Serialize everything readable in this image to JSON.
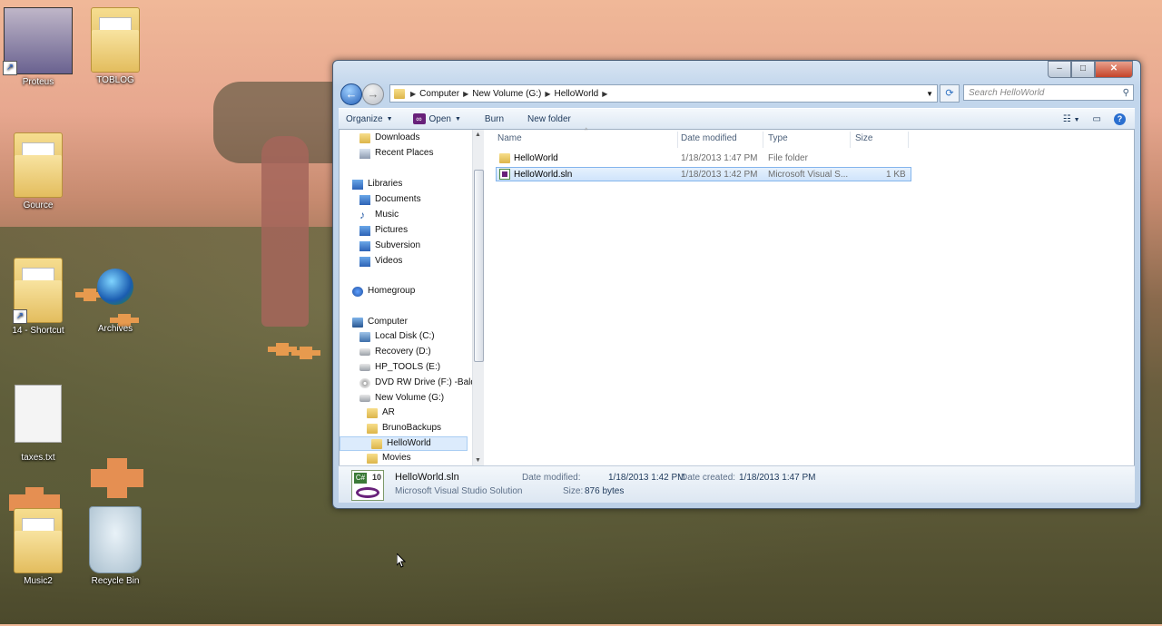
{
  "desktop": {
    "icons": [
      {
        "label": "Proteus"
      },
      {
        "label": "TOBLOG"
      },
      {
        "label": "Gource"
      },
      {
        "label": "14 - Shortcut"
      },
      {
        "label": "Archives"
      },
      {
        "label": "taxes.txt"
      },
      {
        "label": "Music2"
      },
      {
        "label": "Recycle Bin"
      }
    ]
  },
  "window": {
    "caption": {
      "minimize": "–",
      "maximize": "□",
      "close": "✕"
    },
    "address": {
      "segments": [
        "Computer",
        "New Volume (G:)",
        "HelloWorld"
      ]
    },
    "search": {
      "placeholder": "Search HelloWorld"
    },
    "toolbar": {
      "organize": "Organize",
      "open": "Open",
      "burn": "Burn",
      "new_folder": "New folder"
    },
    "nav": {
      "items": [
        {
          "label": "Downloads",
          "icon": "folder-icon"
        },
        {
          "label": "Recent Places",
          "icon": "recent-places-icon"
        },
        {
          "label": "Libraries",
          "icon": "libraries-icon"
        },
        {
          "label": "Documents",
          "icon": "documents-icon"
        },
        {
          "label": "Music",
          "icon": "music-icon"
        },
        {
          "label": "Pictures",
          "icon": "pictures-icon"
        },
        {
          "label": "Subversion",
          "icon": "subversion-icon"
        },
        {
          "label": "Videos",
          "icon": "videos-icon"
        },
        {
          "label": "Homegroup",
          "icon": "homegroup-icon"
        },
        {
          "label": "Computer",
          "icon": "computer-icon"
        },
        {
          "label": "Local Disk (C:)",
          "icon": "local-disk-icon"
        },
        {
          "label": "Recovery (D:)",
          "icon": "drive-icon"
        },
        {
          "label": "HP_TOOLS (E:)",
          "icon": "drive-icon"
        },
        {
          "label": "DVD RW Drive (F:) -Baldv",
          "icon": "dvd-icon"
        },
        {
          "label": "New Volume (G:)",
          "icon": "drive-icon"
        },
        {
          "label": "AR",
          "icon": "folder-icon"
        },
        {
          "label": "BrunoBackups",
          "icon": "folder-icon"
        },
        {
          "label": "HelloWorld",
          "icon": "folder-icon"
        },
        {
          "label": "Movies",
          "icon": "folder-icon"
        }
      ]
    },
    "columns": {
      "name": "Name",
      "date_modified": "Date modified",
      "type": "Type",
      "size": "Size"
    },
    "files": [
      {
        "name": "HelloWorld",
        "date": "1/18/2013 1:47 PM",
        "type": "File folder",
        "size": ""
      },
      {
        "name": "HelloWorld.sln",
        "date": "1/18/2013 1:42 PM",
        "type": "Microsoft Visual S...",
        "size": "1 KB"
      }
    ],
    "details": {
      "filename": "HelloWorld.sln",
      "filetype": "Microsoft Visual Studio Solution",
      "date_modified_label": "Date modified:",
      "date_modified": "1/18/2013 1:42 PM",
      "size_label": "Size:",
      "size": "876 bytes",
      "date_created_label": "Date created:",
      "date_created": "1/18/2013 1:47 PM",
      "version_badge": "10"
    }
  }
}
